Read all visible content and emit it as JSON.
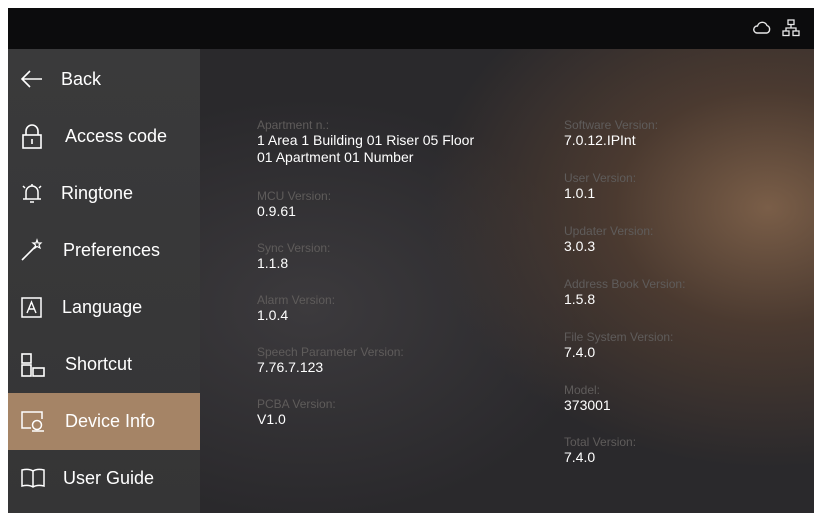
{
  "status_icons": [
    "cloud-icon",
    "network-icon"
  ],
  "sidebar": {
    "items": [
      {
        "label": "Back",
        "icon": "back-arrow-icon"
      },
      {
        "label": "Access code",
        "icon": "lock-icon"
      },
      {
        "label": "Ringtone",
        "icon": "bell-icon"
      },
      {
        "label": "Preferences",
        "icon": "magic-wand-icon"
      },
      {
        "label": "Language",
        "icon": "language-icon"
      },
      {
        "label": "Shortcut",
        "icon": "shortcut-icon"
      },
      {
        "label": "Device Info",
        "icon": "device-info-icon",
        "active": true
      },
      {
        "label": "User Guide",
        "icon": "book-icon"
      }
    ],
    "active_color": "#a58466"
  },
  "info_left": [
    {
      "label": "Apartment n.:",
      "value_lines": [
        "1 Area 1 Building 01 Riser 05 Floor",
        "01 Apartment 01 Number"
      ]
    },
    {
      "label": "MCU Version:",
      "value": "0.9.61"
    },
    {
      "label": "Sync Version:",
      "value": "1.1.8"
    },
    {
      "label": "Alarm Version:",
      "value": "1.0.4"
    },
    {
      "label": "Speech Parameter Version:",
      "value": "7.76.7.123"
    },
    {
      "label": "PCBA Version:",
      "value": "V1.0"
    }
  ],
  "info_right": [
    {
      "label": "Software Version:",
      "value": "7.0.12.IPInt"
    },
    {
      "label": "User Version:",
      "value": "1.0.1"
    },
    {
      "label": "Updater Version:",
      "value": "3.0.3"
    },
    {
      "label": "Address Book Version:",
      "value": "1.5.8"
    },
    {
      "label": "File System Version:",
      "value": "7.4.0"
    },
    {
      "label": "Model:",
      "value": "373001"
    },
    {
      "label": "Total Version:",
      "value": "7.4.0"
    }
  ]
}
